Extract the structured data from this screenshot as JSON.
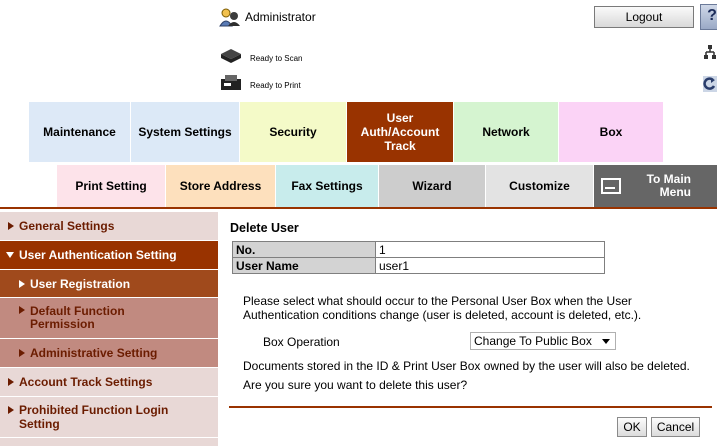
{
  "header": {
    "user_label": "Administrator",
    "logout_label": "Logout",
    "help_label": "?",
    "scan_status": "Ready to Scan",
    "print_status": "Ready to Print"
  },
  "main_tabs": [
    "Maintenance",
    "System Settings",
    "Security",
    "User Auth/Account Track",
    "Network",
    "Box"
  ],
  "sub_tabs": [
    "Print Setting",
    "Store Address",
    "Fax Settings",
    "Wizard",
    "Customize",
    "To Main Menu"
  ],
  "sidebar": {
    "items": [
      "General Settings",
      "User Authentication Setting",
      "User Registration",
      "Default Function Permission",
      "Administrative Setting",
      "Account Track Settings",
      "Prohibited Function Login Setting"
    ]
  },
  "content": {
    "title": "Delete User",
    "rows": [
      {
        "key": "No.",
        "value": "1"
      },
      {
        "key": "User Name",
        "value": "user1"
      }
    ],
    "message": "Please select what should occur to the Personal User Box when the User Authentication conditions change (user is deleted, account is deleted, etc.).",
    "box_op_label": "Box Operation",
    "box_op_value": "Change To Public Box",
    "doc_note": "Documents stored in the ID & Print User Box owned by the user will also be deleted.",
    "confirm": "Are you sure you want to delete this user?",
    "ok_label": "OK",
    "cancel_label": "Cancel"
  },
  "colors": {
    "accent": "#993300",
    "active_sub_item": "#a04a1c",
    "sub_item": "#c18a80",
    "sidebar_item": "#e8d8d6"
  }
}
